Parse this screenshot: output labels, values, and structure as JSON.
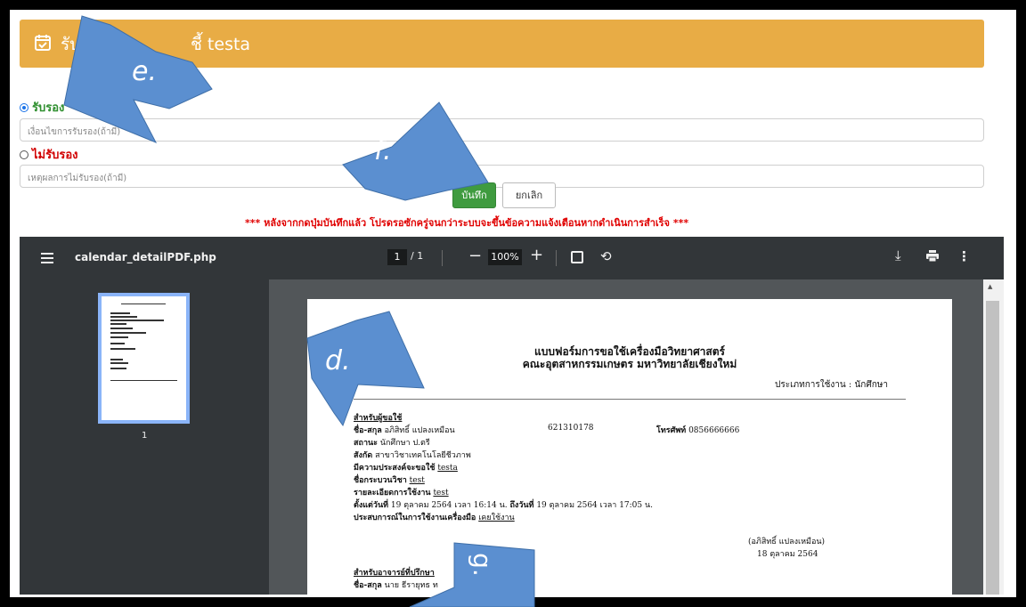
{
  "header": {
    "title_prefix": "รับ",
    "title_suffix": "ชี้ testa"
  },
  "form": {
    "approve_label": "รับรอง",
    "approve_placeholder": "เงื่อนไขการรับรอง(ถ้ามี)",
    "reject_label": "ไม่รับรอง",
    "reject_placeholder": "เหตุผลการไม่รับรอง(ถ้ามี)",
    "save_label": "บันทึก",
    "cancel_label": "ยกเลิก",
    "warning": "*** หลังจากกดปุ่มบันทึกแล้ว โปรดรอซักครู่จนกว่าระบบจะขึ้นข้อความแจ้งเตือนหากดำเนินการสำเร็จ ***"
  },
  "viewer": {
    "doc_title": "calendar_detailPDF.php",
    "page_current": "1",
    "page_total": "/ 1",
    "zoom": "100%",
    "thumb_page": "1"
  },
  "pdf": {
    "title1": "แบบฟอร์มการขอใช้เครื่องมือวิทยาศาสตร์",
    "title2": "คณะอุตสาหกรรมเกษตร มหาวิทยาลัยเชียงใหม่",
    "usage_type": "ประเภทการใช้งาน : นักศึกษา",
    "section_user": "สำหรับผู้ขอใช้",
    "name_label": "ชื่อ-สกุล",
    "name_value": "อภิสิทธิ์ แปลงเหมือน",
    "student_id": "621310178",
    "phone_label": "โทรศัพท์",
    "phone_value": "0856666666",
    "status_label": "สถานะ",
    "status_value": "นักศึกษา ป.ตรี",
    "affiliation_label": "สังกัด",
    "affiliation_value": "สาขาวิชาเทคโนโลยีชีวภาพ",
    "purpose_label": "มีความประสงค์จะขอใช้",
    "purpose_value": "testa",
    "course_label": "ชื่อกระบวนวิชา",
    "course_value": "test",
    "detail_label": "รายละเอียดการใช้งาน",
    "detail_value": "test",
    "from_label": "ตั้งแต่วันที่",
    "from_value": "19 ตุลาคม 2564 เวลา 16:14 น.",
    "to_label": "ถึงวันที่",
    "to_value": "19 ตุลาคม 2564 เวลา 17:05 น.",
    "experience_label": "ประสบการณ์ในการใช้งานเครื่องมือ",
    "experience_value": "เคยใช้งาน",
    "signature_name": "(อภิสิทธิ์ แปลงเหมือน)",
    "signature_date": "18 ตุลาคม 2564",
    "section_advisor": "สำหรับอาจารย์ที่ปรึกษา",
    "advisor_label": "ชื่อ-สกุล",
    "advisor_value": "นาย ธีรายุทธ ท"
  },
  "callouts": {
    "e": "e.",
    "f": "f.",
    "d": "d.",
    "g": "g."
  },
  "colors": {
    "header": "#e8ac45",
    "callout": "#5b8fd0",
    "save": "#3f9b3f",
    "warning": "#e00000"
  }
}
